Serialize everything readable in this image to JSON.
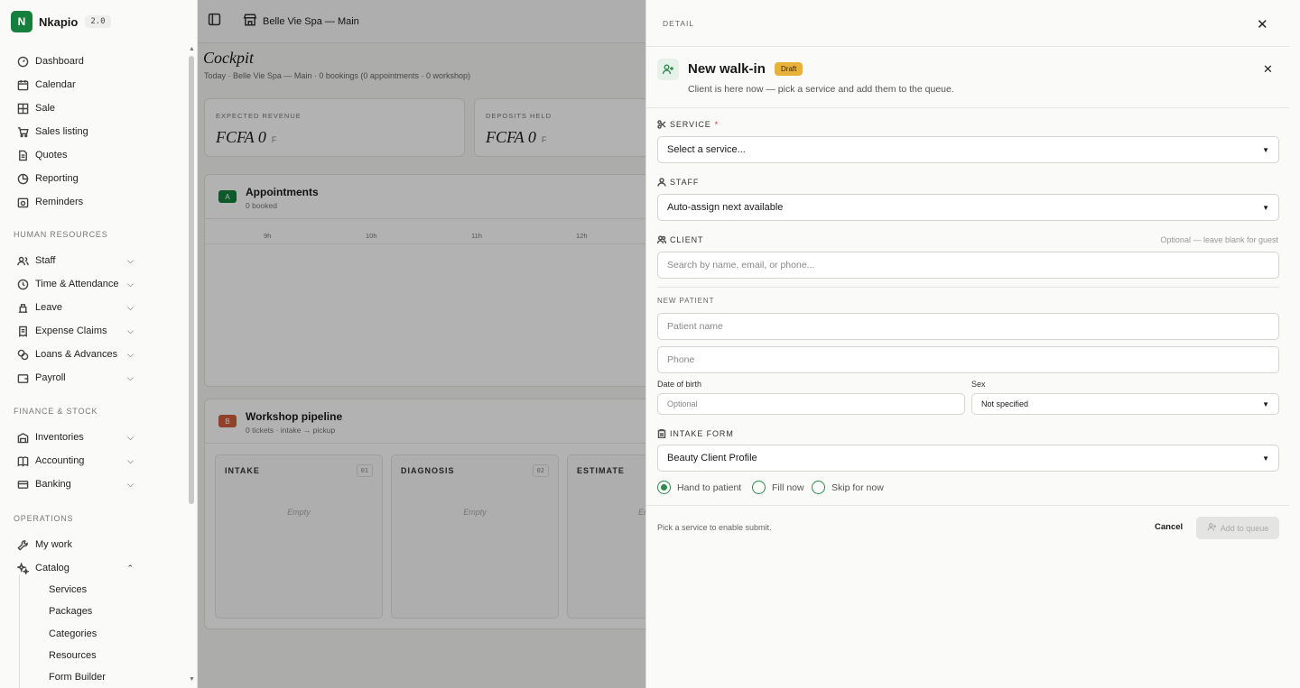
{
  "app": {
    "name": "Nkapio",
    "version": "2.0",
    "logo_letter": "N",
    "brand_color": "#15803d"
  },
  "nav": {
    "main": [
      {
        "label": "Dashboard",
        "icon": "dashboard-icon"
      },
      {
        "label": "Calendar",
        "icon": "calendar-icon"
      },
      {
        "label": "Sale",
        "icon": "grid-icon"
      },
      {
        "label": "Sales listing",
        "icon": "cart-icon"
      },
      {
        "label": "Quotes",
        "icon": "document-icon"
      },
      {
        "label": "Reporting",
        "icon": "pie-chart-icon"
      },
      {
        "label": "Reminders",
        "icon": "reminder-icon"
      }
    ],
    "hr_section": "HUMAN RESOURCES",
    "hr": [
      {
        "label": "Staff",
        "icon": "users-icon"
      },
      {
        "label": "Time & Attendance",
        "icon": "clock-icon"
      },
      {
        "label": "Leave",
        "icon": "leave-icon"
      },
      {
        "label": "Expense Claims",
        "icon": "receipt-icon"
      },
      {
        "label": "Loans & Advances",
        "icon": "coins-icon"
      },
      {
        "label": "Payroll",
        "icon": "wallet-icon"
      }
    ],
    "finance_section": "FINANCE & STOCK",
    "finance": [
      {
        "label": "Inventories",
        "icon": "warehouse-icon"
      },
      {
        "label": "Accounting",
        "icon": "book-icon"
      },
      {
        "label": "Banking",
        "icon": "bank-icon"
      }
    ],
    "ops_section": "OPERATIONS",
    "ops": [
      {
        "label": "My work",
        "icon": "wrench-icon"
      },
      {
        "label": "Catalog",
        "icon": "sparkles-icon"
      }
    ],
    "catalog_sub": [
      "Services",
      "Packages",
      "Categories",
      "Resources",
      "Form Builder"
    ]
  },
  "topbar": {
    "location": "Belle Vie Spa — Main"
  },
  "cockpit": {
    "title": "Cockpit",
    "crumb": "Today · Belle Vie Spa — Main · 0 bookings (0 appointments · 0 workshop)",
    "kpis": [
      {
        "label": "EXPECTED REVENUE",
        "value": "FCFA 0",
        "unit": "F"
      },
      {
        "label": "DEPOSITS HELD",
        "value": "FCFA 0",
        "unit": "F"
      }
    ],
    "appointments": {
      "badge": "A",
      "title": "Appointments",
      "sub": "0 booked",
      "hours": [
        "9h",
        "10h",
        "11h",
        "12h"
      ]
    },
    "workshop": {
      "badge": "B",
      "title": "Workshop pipeline",
      "sub": "0 tickets · intake → pickup",
      "columns": [
        {
          "title": "INTAKE",
          "num": "01",
          "empty": "Empty"
        },
        {
          "title": "DIAGNOSIS",
          "num": "02",
          "empty": "Empty"
        },
        {
          "title": "ESTIMATE",
          "num": "",
          "empty": "Em"
        }
      ]
    }
  },
  "drawer": {
    "header": "DETAIL",
    "title": "New walk-in",
    "status": "Draft",
    "subtitle": "Client is here now — pick a service and add them to the queue.",
    "service": {
      "label": "SERVICE",
      "required": "*",
      "value": "Select a service..."
    },
    "staff": {
      "label": "STAFF",
      "value": "Auto-assign next available"
    },
    "client": {
      "label": "CLIENT",
      "hint": "Optional — leave blank for guest",
      "placeholder": "Search by name, email, or phone..."
    },
    "new_patient": {
      "label": "NEW PATIENT",
      "name_placeholder": "Patient name",
      "phone_placeholder": "Phone",
      "dob_label": "Date of birth",
      "dob_placeholder": "Optional",
      "sex_label": "Sex",
      "sex_value": "Not specified"
    },
    "intake": {
      "label": "INTAKE FORM",
      "value": "Beauty Client Profile",
      "options": [
        "Hand to patient",
        "Fill now",
        "Skip for now"
      ],
      "selected": "Hand to patient"
    },
    "footer": {
      "hint": "Pick a service to enable submit.",
      "cancel": "Cancel",
      "submit": "Add to queue"
    }
  }
}
